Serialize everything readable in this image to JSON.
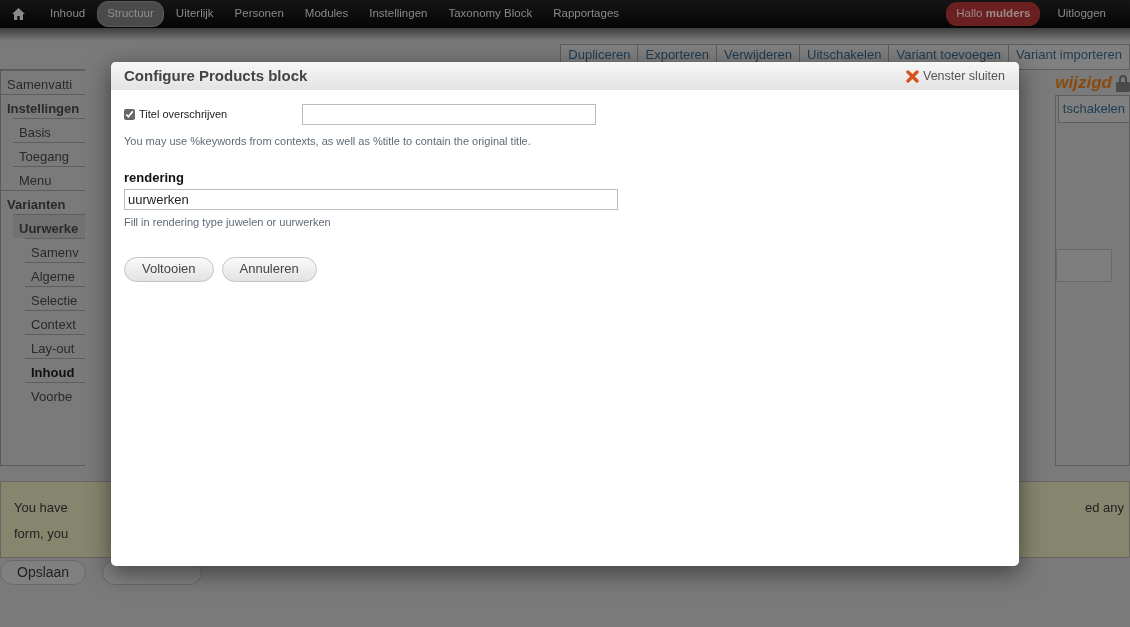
{
  "toolbar": {
    "items": [
      {
        "label": "Inhoud",
        "selected": false
      },
      {
        "label": "Structuur",
        "selected": true
      },
      {
        "label": "Uiterlijk",
        "selected": false
      },
      {
        "label": "Personen",
        "selected": false
      },
      {
        "label": "Modules",
        "selected": false
      },
      {
        "label": "Instellingen",
        "selected": false
      },
      {
        "label": "Taxonomy Block",
        "selected": false
      },
      {
        "label": "Rapportages",
        "selected": false
      }
    ],
    "greeting": "Hallo **mulders**",
    "logout": "Uitloggen"
  },
  "action_tabs": [
    "Dupliceren",
    "Exporteren",
    "Verwijderen",
    "Uitschakelen",
    "Variant toevoegen",
    "Variant importeren"
  ],
  "status_text": "wijzigd",
  "side_button": "tschakelen",
  "sidebar": {
    "items": [
      {
        "label": "Samenvatti",
        "selected": false
      },
      {
        "label": "Instellingen",
        "selected": false,
        "children": [
          {
            "label": "Basis",
            "selected": false
          },
          {
            "label": "Toegang",
            "selected": false
          },
          {
            "label": "Menu",
            "selected": false
          }
        ]
      },
      {
        "label": "Varianten",
        "selected": false,
        "children": [
          {
            "label": "Uurwerke",
            "selected": false,
            "children": [
              {
                "label": "Samenv",
                "selected": false
              },
              {
                "label": "Algeme",
                "selected": false
              },
              {
                "label": "Selectie",
                "selected": false
              },
              {
                "label": "Context",
                "selected": false
              },
              {
                "label": "Lay-out",
                "selected": false
              },
              {
                "label": "Inhoud",
                "selected": true
              },
              {
                "label": "Voorbe",
                "selected": false
              }
            ]
          }
        ]
      }
    ]
  },
  "message": {
    "left_lines": [
      "You have",
      "form, you"
    ],
    "right_text": "ed any"
  },
  "form_buttons": [
    "Opslaan"
  ],
  "modal": {
    "title": "Configure Products block",
    "close_label": "Venster sluiten",
    "override": {
      "label": "Titel overschrijven",
      "checked": true
    },
    "override_help": "You may use %keywords from contexts, as well as %title to contain the original title.",
    "field_label": "rendering",
    "field_value": "uurwerken",
    "field_help": "Fill in rendering type juwelen or uurwerken",
    "buttons": [
      "Voltooien",
      "Annuleren"
    ]
  }
}
